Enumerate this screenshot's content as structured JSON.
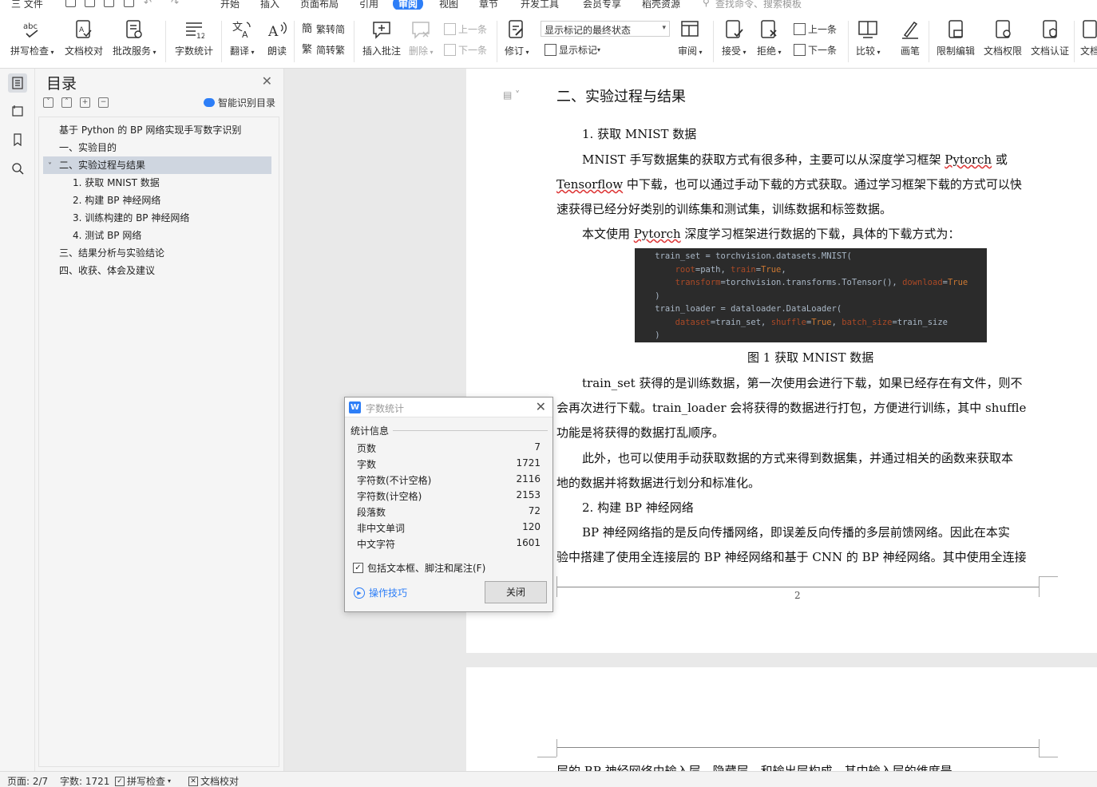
{
  "menu": {
    "file": "三 文件",
    "items": [
      "开始",
      "插入",
      "页面布局",
      "引用",
      "审阅",
      "视图",
      "章节",
      "开发工具",
      "会员专享",
      "稻壳资源"
    ],
    "active": "审阅",
    "search": "查找命令、搜索模板"
  },
  "ribbon": {
    "spell_check": "拼写检查",
    "doc_proof": "文档校对",
    "revise_service": "批改服务",
    "word_count": "字数统计",
    "translate": "翻译",
    "read_aloud": "朗读",
    "trad_to_simp": "繁转简",
    "simp_to_trad": "简转繁",
    "insert_comment": "插入批注",
    "delete": "删除",
    "prev": "上一条",
    "next": "下一条",
    "revise": "修订",
    "show_markup_state": "显示标记的最终状态",
    "show_markup": "显示标记",
    "review": "审阅",
    "accept": "接受",
    "reject": "拒绝",
    "prev2": "上一条",
    "next2": "下一条",
    "compare": "比较",
    "pen": "画笔",
    "restrict_edit": "限制编辑",
    "doc_permission": "文档权限",
    "doc_auth": "文档认证",
    "more": "文档"
  },
  "toc": {
    "title": "目录",
    "smart": "智能识别目录",
    "items": [
      "基于 Python 的 BP 网络实现手写数字识别",
      "一、实验目的",
      "二、实验过程与结果",
      "1. 获取 MNIST 数据",
      "2. 构建 BP 神经网络",
      "3. 训练构建的 BP 神经网络",
      "4. 测试 BP 网络",
      "三、结果分析与实验结论",
      "四、收获、体会及建议"
    ]
  },
  "doc": {
    "heading": "二、实验过程与结果",
    "sub1": "1. 获取 MNIST 数据",
    "p1_l1a": "MNIST 手写数据集的获取方式有很多种，主要可以从深度学习框架 ",
    "p1_l1b": "Pytorch",
    "p1_l1c": " 或",
    "p1_l2a": "Tensorflow",
    "p1_l2b": " 中下载，也可以通过手动下载的方式获取。通过学习框架下载的方式可以快",
    "p1_l3": "速获得已经分好类别的训练集和测试集，训练数据和标签数据。",
    "p2a": "本文使用 ",
    "p2b": "Pytorch",
    "p2c": " 深度学习框架进行数据的下载，具体的下载方式为：",
    "code": [
      "    train_set = torchvision.datasets.MNIST(",
      "        root=path, train=True,",
      "        transform=torchvision.transforms.ToTensor(), download=True",
      "    )",
      "    train_loader = dataloader.DataLoader(",
      "        dataset=train_set, shuffle=True, batch_size=train_size",
      "    )"
    ],
    "caption": "图 1 获取 MNIST 数据",
    "p3_l1": "train_set 获得的是训练数据，第一次使用会进行下载，如果已经存在有文件，则不",
    "p3_l2": "会再次进行下载。train_loader 会将获得的数据进行打包，方便进行训练，其中 shuffle",
    "p3_l3": "功能是将获得的数据打乱顺序。",
    "p4_l1": "此外，也可以使用手动获取数据的方式来得到数据集，并通过相关的函数来获取本",
    "p4_l2": "地的数据并将数据进行划分和标准化。",
    "sub2": "2. 构建 BP 神经网络",
    "p5_l1": "BP 神经网络指的是反向传播网络，即误差反向传播的多层前馈网络。因此在本实",
    "p5_l2": "验中搭建了使用全连接层的 BP 神经网络和基于 CNN 的 BP 神经网络。其中使用全连接",
    "page_number": "2",
    "next_page_line": "层的 BP 神经网络由输入层、隐藏层，和输出层构成，其中输入层的维度是"
  },
  "dialog": {
    "title": "字数统计",
    "section": "统计信息",
    "stats": [
      {
        "label": "页数",
        "value": "7"
      },
      {
        "label": "字数",
        "value": "1721"
      },
      {
        "label": "字符数(不计空格)",
        "value": "2116"
      },
      {
        "label": "字符数(计空格)",
        "value": "2153"
      },
      {
        "label": "段落数",
        "value": "72"
      },
      {
        "label": "非中文单词",
        "value": "120"
      },
      {
        "label": "中文字符",
        "value": "1601"
      }
    ],
    "checkbox": "包括文本框、脚注和尾注(F)",
    "tips": "操作技巧",
    "close": "关闭"
  },
  "status": {
    "page": "页面: 2/7",
    "words": "字数: 1721",
    "spell": "拼写检查",
    "proof": "文档校对"
  },
  "colors": {
    "accent": "#2d7ef7",
    "code_bg": "#2b2b2b",
    "toc_selected": "#cfd6e0"
  }
}
